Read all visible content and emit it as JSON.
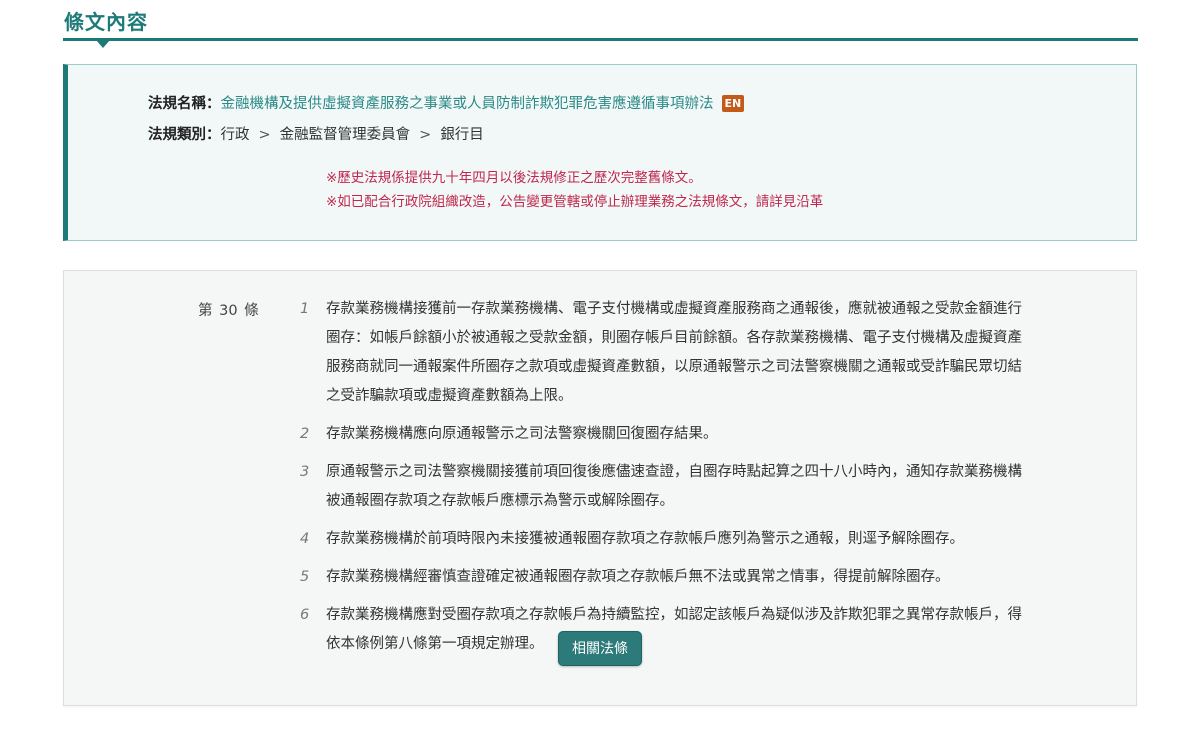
{
  "section": {
    "title": "條文內容"
  },
  "info": {
    "name_label": "法規名稱：",
    "name_value": "金融機構及提供虛擬資產服務之事業或人員防制詐欺犯罪危害應遵循事項辦法",
    "en_badge": "EN",
    "category_label": "法規類別：",
    "category": [
      "行政",
      "金融監督管理委員會",
      "銀行目"
    ],
    "category_separator": ">",
    "notes": [
      "※歷史法規係提供九十年四月以後法規修正之歷次完整舊條文。",
      "※如已配合行政院組織改造，公告變更管轄或停止辦理業務之法規條文，請詳見沿革"
    ]
  },
  "article": {
    "number": "第 30 條",
    "paragraphs": [
      {
        "num": "1",
        "text": "存款業務機構接獲前一存款業務機構、電子支付機構或虛擬資產服務商之通報後，應就被通報之受款金額進行圈存：如帳戶餘額小於被通報之受款金額，則圈存帳戶目前餘額。各存款業務機構、電子支付機構及虛擬資產服務商就同一通報案件所圈存之款項或虛擬資產數額，以原通報警示之司法警察機關之通報或受詐騙民眾切結之受詐騙款項或虛擬資產數額為上限。"
      },
      {
        "num": "2",
        "text": "存款業務機構應向原通報警示之司法警察機關回復圈存結果。"
      },
      {
        "num": "3",
        "text": "原通報警示之司法警察機關接獲前項回復後應儘速查證，自圈存時點起算之四十八小時內，通知存款業務機構被通報圈存款項之存款帳戶應標示為警示或解除圈存。"
      },
      {
        "num": "4",
        "text": "存款業務機構於前項時限內未接獲被通報圈存款項之存款帳戶應列為警示之通報，則逕予解除圈存。"
      },
      {
        "num": "5",
        "text": "存款業務機構經審慎查證確定被通報圈存款項之存款帳戶無不法或異常之情事，得提前解除圈存。"
      },
      {
        "num": "6",
        "text": "存款業務機構應對受圈存款項之存款帳戶為持續監控，如認定該帳戶為疑似涉及詐欺犯罪之異常存款帳戶，得依本條例第八條第一項規定辦理。"
      }
    ],
    "related_button": "相關法條"
  },
  "colors": {
    "accent": "#1d7a78",
    "link": "#2b8a86",
    "note": "#c0284d",
    "badge": "#c45a1a",
    "button": "#2d7a7a"
  }
}
